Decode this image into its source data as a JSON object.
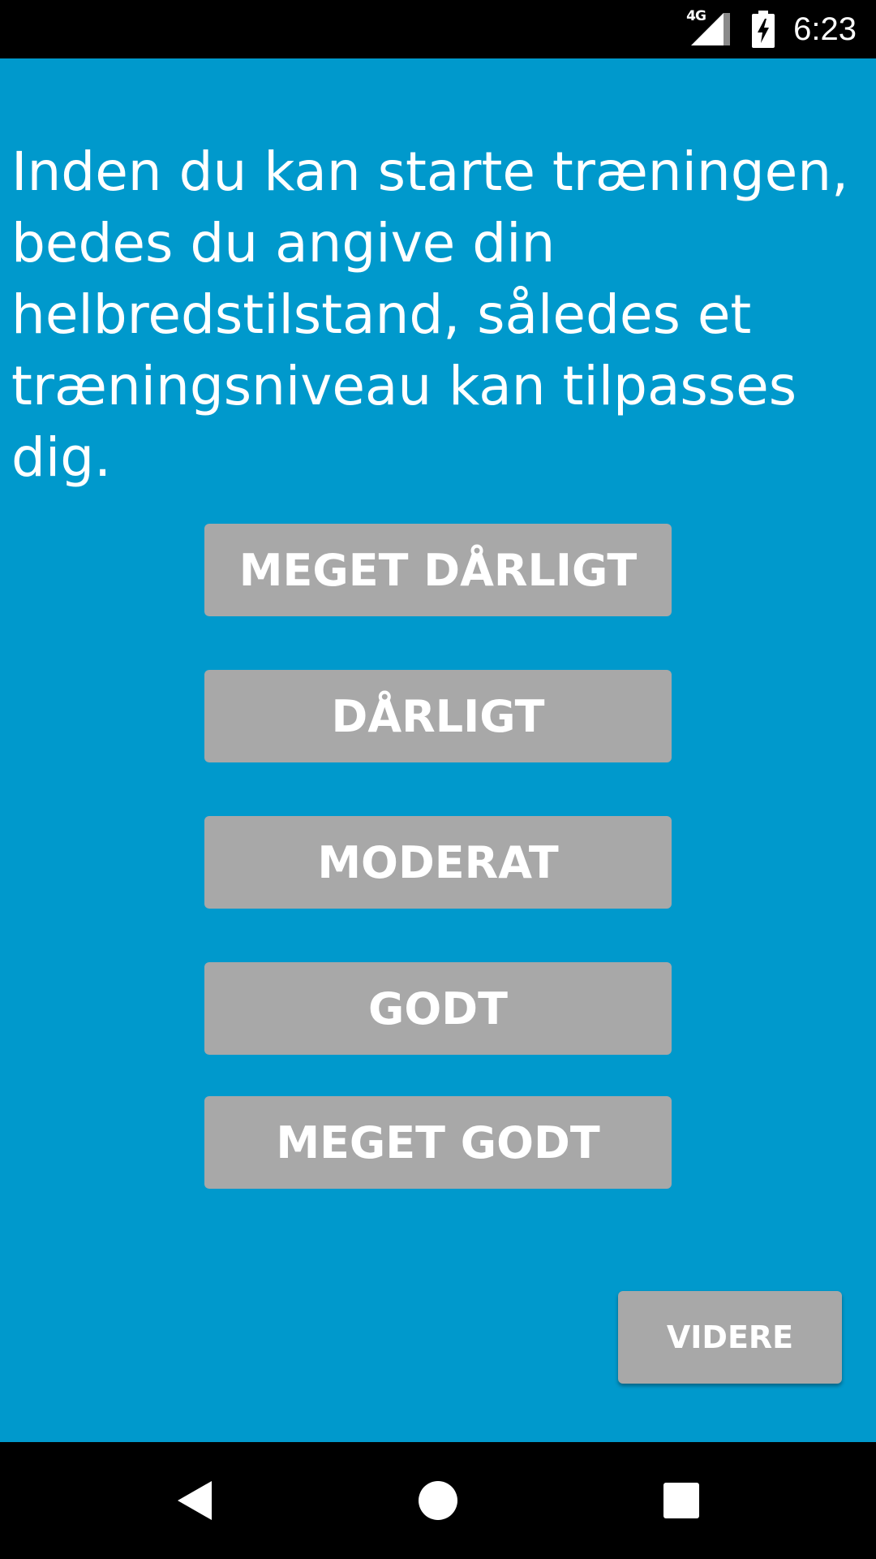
{
  "status_bar": {
    "network_label": "4G",
    "time": "6:23",
    "icons": [
      "cell-signal-icon",
      "battery-charging-icon"
    ]
  },
  "intro_text": "Inden du kan starte træningen, bedes du angive din helbredstilstand, således et træningsniveau kan tilpasses dig.",
  "health_options": [
    {
      "label": "MEGET DÅRLIGT"
    },
    {
      "label": "DÅRLIGT"
    },
    {
      "label": "MODERAT"
    },
    {
      "label": "GODT"
    },
    {
      "label": "MEGET GODT"
    }
  ],
  "next_label": "VIDERE",
  "navigation": {
    "icons": [
      "back-icon",
      "home-icon",
      "recents-icon"
    ]
  },
  "colors": {
    "background": "#0099cc",
    "button": "#a8a8a8",
    "text": "#ffffff",
    "system_bars": "#000000"
  }
}
